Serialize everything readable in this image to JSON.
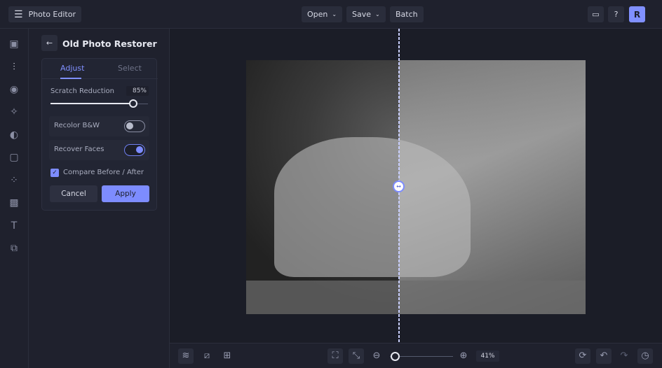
{
  "header": {
    "app_title": "Photo Editor",
    "open_label": "Open",
    "save_label": "Save",
    "batch_label": "Batch",
    "avatar_initial": "R"
  },
  "panel": {
    "title": "Old Photo Restorer",
    "tabs": [
      {
        "label": "Adjust",
        "active": true
      },
      {
        "label": "Select",
        "active": false
      }
    ],
    "scratch_label": "Scratch Reduction",
    "scratch_value": "85%",
    "scratch_fraction": 0.85,
    "recolor_label": "Recolor B&W",
    "recolor_on": false,
    "faces_label": "Recover Faces",
    "faces_on": true,
    "compare_label": "Compare Before / After",
    "compare_checked": true,
    "cancel_label": "Cancel",
    "apply_label": "Apply"
  },
  "bottom": {
    "zoom_value": "41%",
    "zoom_fraction": 0.05
  },
  "colors": {
    "accent": "#7d8cff",
    "bg": "#1c1e29"
  }
}
